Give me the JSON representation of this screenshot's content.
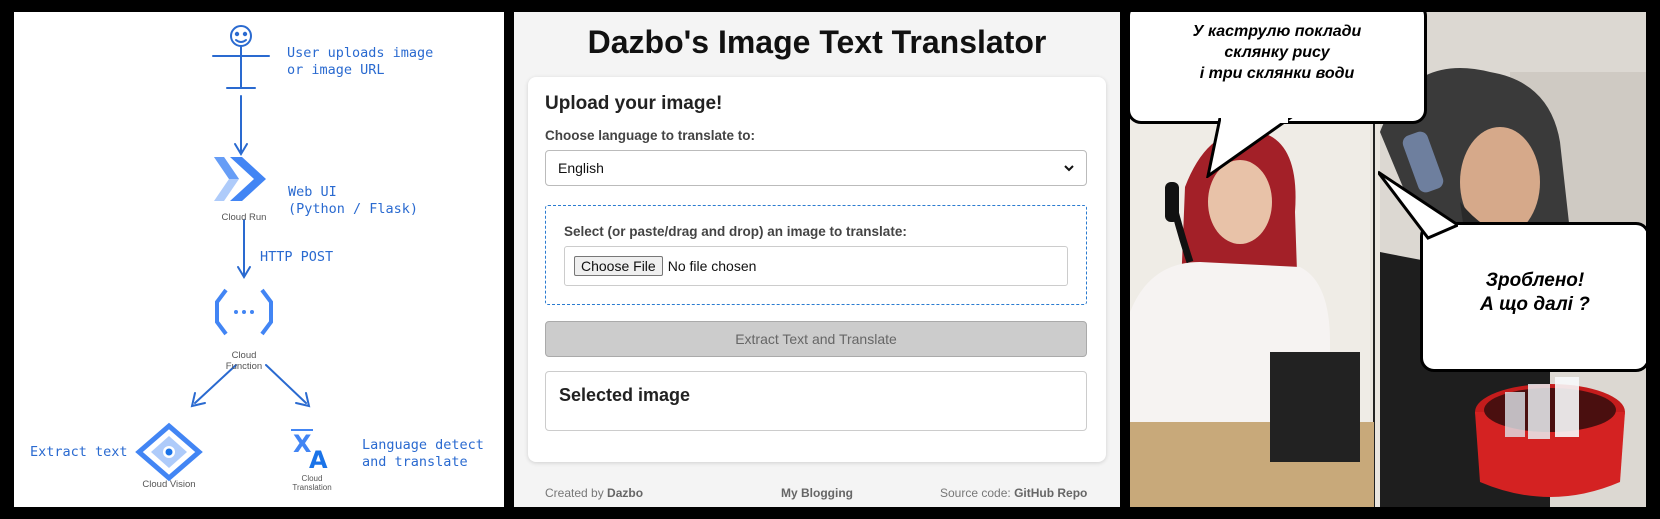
{
  "diagram": {
    "steps": {
      "user": "User uploads image\nor image URL",
      "webui": "Web UI\n(Python / Flask)",
      "http": "HTTP POST",
      "extract": "Extract text",
      "translate": "Language detect\nand translate"
    },
    "services": {
      "cloud_run": "Cloud Run",
      "cloud_function": "Cloud\nFunction",
      "cloud_vision": "Cloud Vision",
      "cloud_translation": "Cloud\nTranslation"
    },
    "colors": {
      "line": "#2a6ad0"
    }
  },
  "app": {
    "title": "Dazbo's Image Text Translator",
    "upload_heading": "Upload your image!",
    "language_label": "Choose language to translate to:",
    "language_selected": "English",
    "dropzone_label": "Select (or paste/drag and drop) an image to translate:",
    "choose_file_label": "Choose File",
    "no_file_text": "No file chosen",
    "extract_button": "Extract Text and Translate",
    "selected_image_heading": "Selected image",
    "footer": {
      "created_by_prefix": "Created by",
      "created_by_name": "Dazbo",
      "blogging": "My Blogging",
      "source_prefix": "Source code:",
      "source_link": "GitHub Repo"
    }
  },
  "comic": {
    "bubble_top": "У каструлю поклади\nсклянку рису\nі три склянки води",
    "bubble_right": "Зроблено!\nА що далі ?"
  }
}
